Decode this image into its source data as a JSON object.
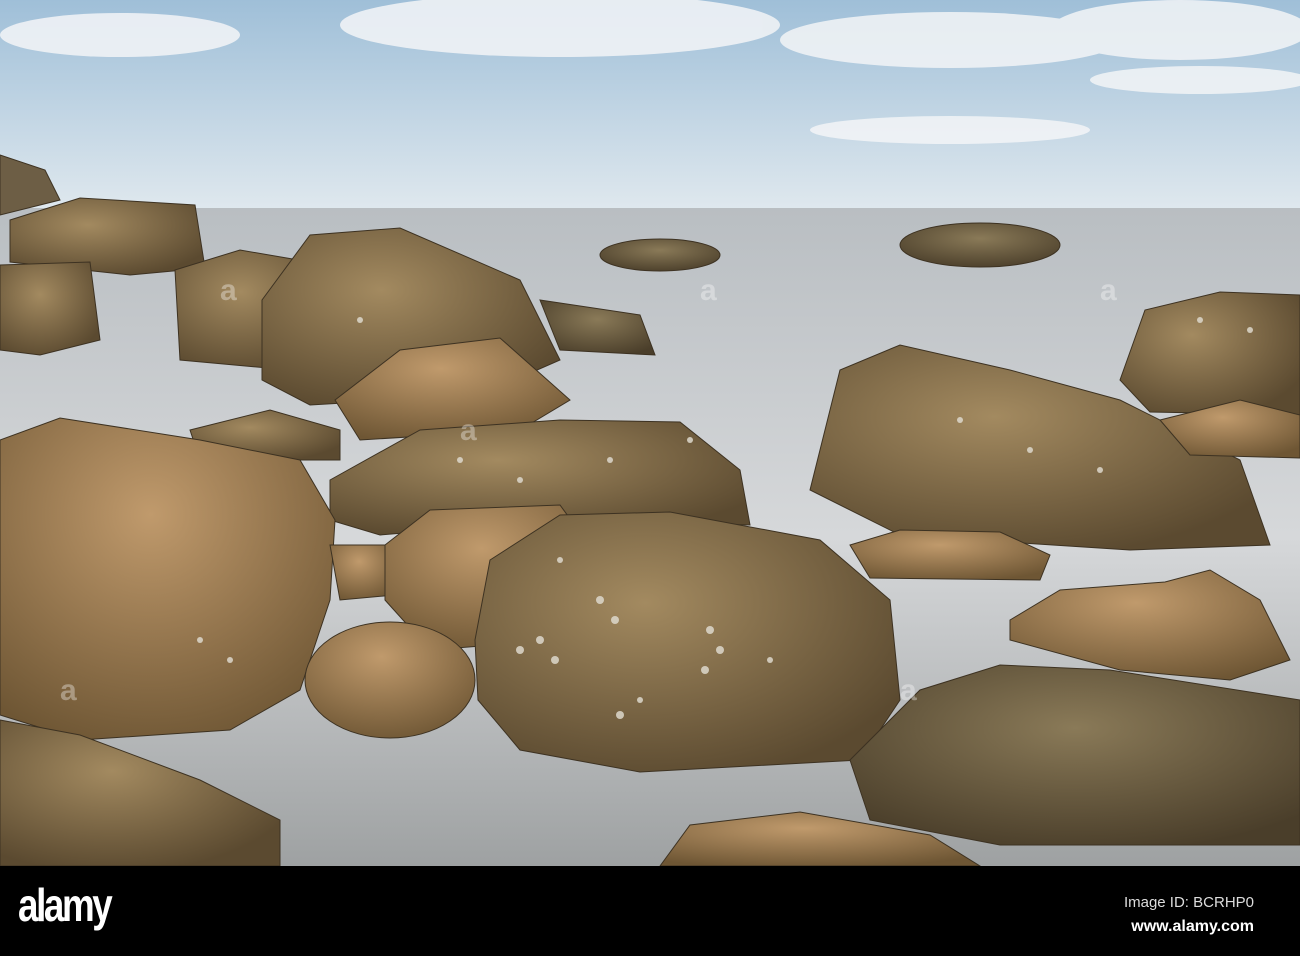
{
  "photo": {
    "subject": "barnacle-covered boulders on a misty shoreline"
  },
  "footer": {
    "logo": "alamy",
    "image_id": "Image ID: BCRHP0",
    "url": "www.alamy.com"
  },
  "colors": {
    "sky": "#c9dcea",
    "sea": "#c8cccf",
    "rock": "#7a6844",
    "footer": "#000000"
  }
}
